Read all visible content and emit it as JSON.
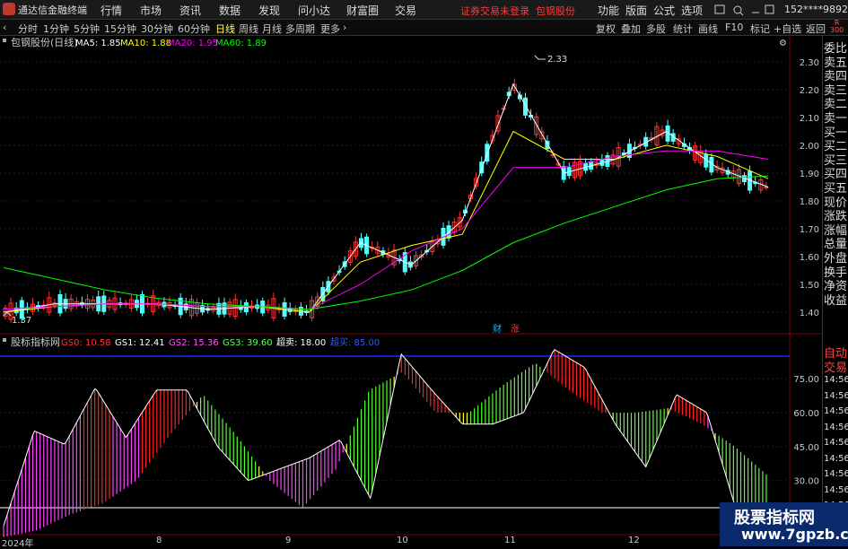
{
  "app": {
    "title": "通达信金融终端"
  },
  "menu": [
    "行情",
    "市场",
    "资讯",
    "数据",
    "发现",
    "问小达",
    "财富圈",
    "交易"
  ],
  "login_notice": "证券交易未登录",
  "stock_name_red": "包钢股份",
  "right_menu": [
    "功能",
    "版面",
    "公式",
    "选项"
  ],
  "user": "152****9892",
  "toolbar": {
    "items": [
      "分时",
      "1分钟",
      "5分钟",
      "15分钟",
      "30分钟",
      "60分钟",
      "日线",
      "周线",
      "月线",
      "多周期",
      "更多"
    ],
    "active": "日线"
  },
  "right_toolbar": [
    "复权",
    "叠加",
    "多股",
    "统计",
    "画线",
    "F10",
    "标记",
    "+自选",
    "返回"
  ],
  "r300": {
    "top": "R",
    "bottom": "300"
  },
  "main_chart": {
    "title": "包钢股份(日线)",
    "ma": [
      {
        "name": "MA5",
        "value": "1.85",
        "color": "#ffffff"
      },
      {
        "name": "MA10",
        "value": "1.88",
        "color": "#ffff00"
      },
      {
        "name": "MA20",
        "value": "1.95",
        "color": "#ff00ff"
      },
      {
        "name": "MA60",
        "value": "1.89",
        "color": "#00ff00"
      }
    ],
    "high_label": "2.33",
    "low_label": "1.37",
    "y_ticks": [
      "2.30",
      "2.20",
      "2.10",
      "2.00",
      "1.90",
      "1.80",
      "1.70",
      "1.60",
      "1.50",
      "1.40"
    ],
    "markers": [
      {
        "text": "财",
        "color": "#00c0ff"
      },
      {
        "text": "涨",
        "color": "#ff3333"
      }
    ]
  },
  "sub_chart": {
    "title": "股标指标网",
    "items": [
      {
        "name": "GS0",
        "value": "10.58",
        "color": "#ff3333"
      },
      {
        "name": "GS1",
        "value": "12.41",
        "color": "#ffffff"
      },
      {
        "name": "GS2",
        "value": "15.36",
        "color": "#ff55ff"
      },
      {
        "name": "GS3",
        "value": "39.60",
        "color": "#66ff66"
      },
      {
        "name": "超卖",
        "value": "18.00",
        "color": "#ffffff"
      },
      {
        "name": "超买",
        "value": "85.00",
        "color": "#3355ff"
      }
    ],
    "y_ticks": [
      "75.00",
      "60.00",
      "45.00",
      "30.00"
    ]
  },
  "side_panel": [
    "委比",
    "卖五",
    "卖四",
    "卖三",
    "卖二",
    "卖一",
    "买一",
    "买二",
    "买三",
    "买四",
    "买五",
    "现价",
    "涨跌",
    "涨幅",
    "总量",
    "外盘",
    "换手",
    "净资",
    "收益"
  ],
  "side_panel_lower": {
    "items": [
      "自动",
      "交易"
    ],
    "time_label": "14:56"
  },
  "x_labels": [
    "2024年",
    "8",
    "9",
    "10",
    "11",
    "12"
  ],
  "watermark": {
    "line1": "股票指标网",
    "line2": "www.7gpzb.com"
  },
  "chart_data": [
    {
      "type": "line",
      "title": "包钢股份(日线)",
      "x": [
        "2024年",
        "8",
        "9",
        "10",
        "11",
        "12"
      ],
      "series": [
        {
          "name": "MA5",
          "values": [
            1.4,
            1.43,
            1.43,
            1.43,
            1.41,
            1.42,
            1.4,
            1.65,
            1.57,
            1.73,
            2.22,
            1.9,
            1.95,
            2.05,
            1.92,
            1.85
          ]
        },
        {
          "name": "MA10",
          "values": [
            1.4,
            1.42,
            1.43,
            1.43,
            1.42,
            1.42,
            1.4,
            1.58,
            1.64,
            1.68,
            2.05,
            1.95,
            1.95,
            2.0,
            1.96,
            1.88
          ]
        },
        {
          "name": "MA20",
          "values": [
            1.41,
            1.42,
            1.43,
            1.43,
            1.42,
            1.42,
            1.41,
            1.5,
            1.62,
            1.7,
            1.92,
            1.92,
            1.96,
            1.98,
            1.98,
            1.95
          ]
        },
        {
          "name": "MA60",
          "values": [
            1.56,
            1.52,
            1.48,
            1.45,
            1.43,
            1.42,
            1.41,
            1.44,
            1.48,
            1.55,
            1.65,
            1.72,
            1.78,
            1.84,
            1.88,
            1.89
          ]
        }
      ],
      "ylim": [
        1.35,
        2.35
      ]
    },
    {
      "type": "line",
      "title": "股标指标网",
      "series": [
        {
          "name": "GS1",
          "values": [
            10,
            52,
            46,
            71,
            49,
            70,
            70,
            45,
            30,
            35,
            40,
            48,
            22,
            86,
            70,
            55,
            55,
            60,
            88,
            80,
            55,
            36,
            68,
            60,
            15,
            5
          ]
        },
        {
          "name": "GS3",
          "values": [
            5,
            8,
            15,
            20,
            30,
            50,
            68,
            50,
            30,
            18,
            35,
            70,
            78,
            60,
            60,
            72,
            82,
            70,
            60,
            60,
            62,
            55,
            45,
            32
          ]
        }
      ],
      "ylim": [
        0,
        95
      ]
    }
  ]
}
